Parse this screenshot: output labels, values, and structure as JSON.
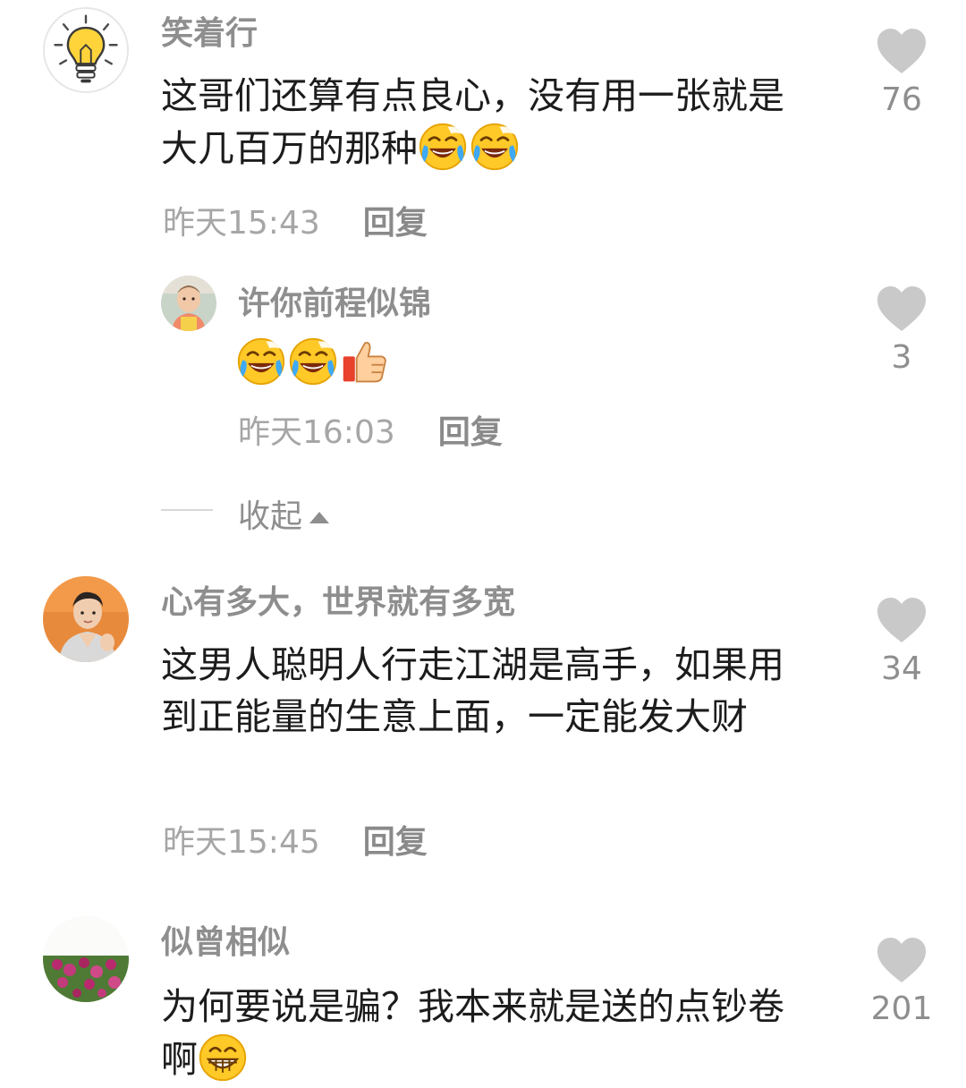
{
  "comments": [
    {
      "username": "笑着行",
      "text": "这哥们还算有点良心，没有用一张就是大几百万的那种",
      "emojis": [
        "laughing-crying-face",
        "laughing-crying-face"
      ],
      "time": "昨天15:43",
      "reply_label": "回复",
      "likes": "76",
      "avatar": "lightbulb"
    },
    {
      "username": "许你前程似锦",
      "text": "",
      "emojis": [
        "laughing-crying-face",
        "laughing-crying-face",
        "thumbs-up"
      ],
      "time": "昨天16:03",
      "reply_label": "回复",
      "likes": "3",
      "avatar": "child-photo",
      "is_reply": true
    },
    {
      "username": "心有多大，世界就有多宽",
      "text": "这男人聪明人行走江湖是高手，如果用到正能量的生意上面，一定能发大财",
      "emojis": [],
      "time": "昨天15:45",
      "reply_label": "回复",
      "likes": "34",
      "avatar": "man-photo"
    },
    {
      "username": "似曾相似",
      "text": "为何要说是骗？我本来就是送的点钞卷啊",
      "emojis": [
        "grinning-face"
      ],
      "time": "",
      "reply_label": "",
      "likes": "201",
      "avatar": "flowers-photo"
    }
  ],
  "collapse_label": "收起",
  "colors": {
    "username": "#8e8e8e",
    "text": "#1c1c1c",
    "time": "#a6a6a6",
    "heart": "#c9c9c9",
    "emoji_face": "#ffc928"
  }
}
